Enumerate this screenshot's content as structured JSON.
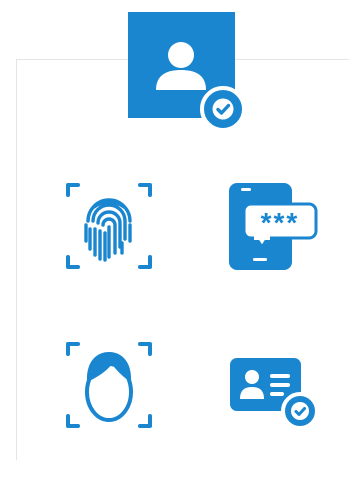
{
  "colors": {
    "accent": "#1a86d0",
    "panel_border": "#e4e4e4",
    "background": "#ffffff"
  },
  "header": {
    "icon": "user-icon",
    "badge_icon": "checkmark-badge-icon"
  },
  "auth_methods": [
    {
      "icon": "fingerprint-scan-icon"
    },
    {
      "icon": "phone-password-icon",
      "masked_text": "***"
    },
    {
      "icon": "face-scan-icon"
    },
    {
      "icon": "id-card-verified-icon"
    }
  ]
}
